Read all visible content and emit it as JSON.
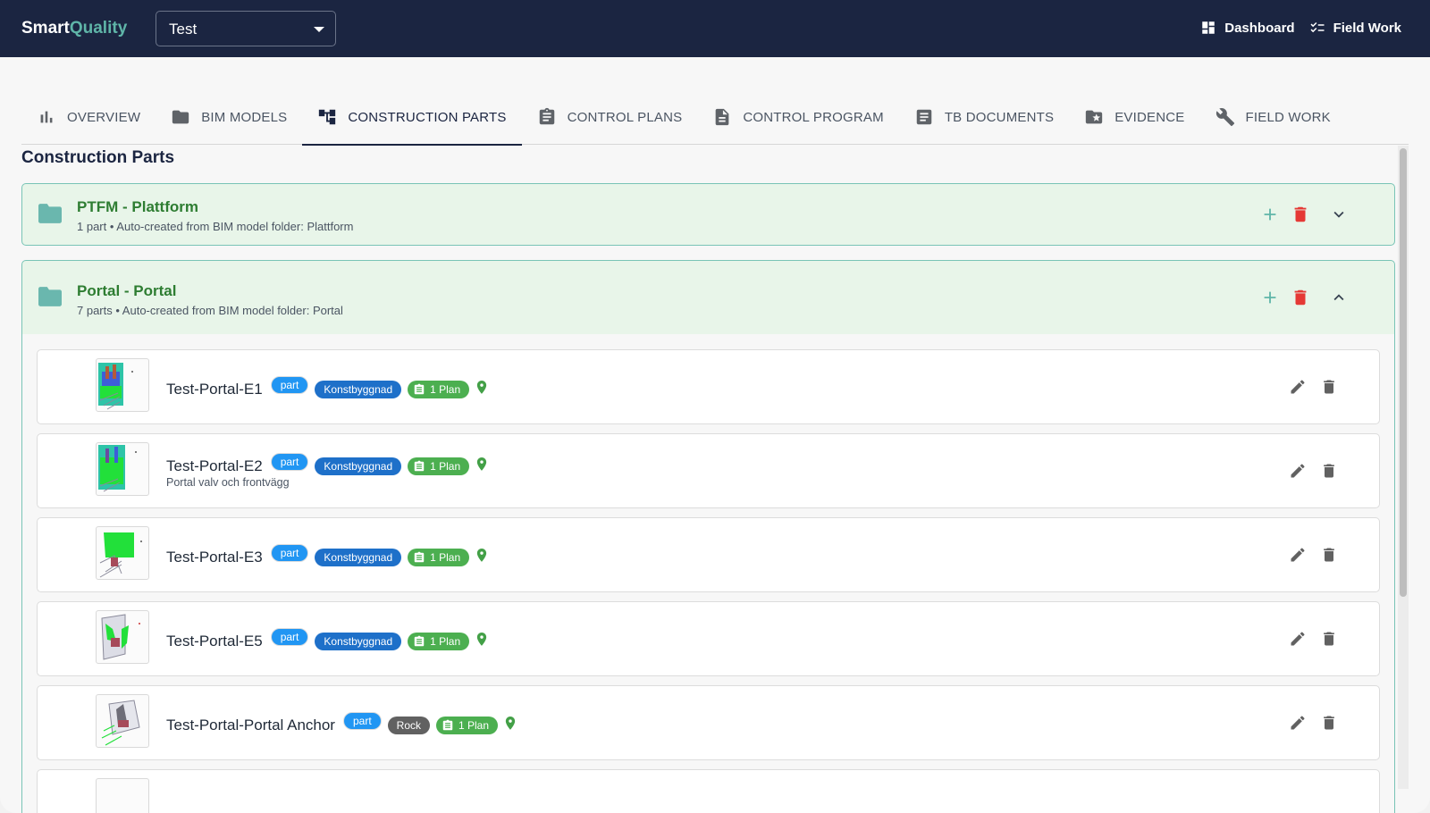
{
  "app": {
    "brand_part1": "Smart",
    "brand_part2": "Quality"
  },
  "project_select": {
    "value": "Test"
  },
  "top_nav": {
    "dashboard": "Dashboard",
    "field_work": "Field Work"
  },
  "tabs": [
    {
      "label": "OVERVIEW",
      "icon": "bar-chart-icon"
    },
    {
      "label": "BIM MODELS",
      "icon": "folder-icon"
    },
    {
      "label": "CONSTRUCTION PARTS",
      "icon": "hierarchy-icon",
      "active": true
    },
    {
      "label": "CONTROL PLANS",
      "icon": "clipboard-icon"
    },
    {
      "label": "CONTROL PROGRAM",
      "icon": "document-icon"
    },
    {
      "label": "TB DOCUMENTS",
      "icon": "article-icon"
    },
    {
      "label": "EVIDENCE",
      "icon": "starred-folder-icon"
    },
    {
      "label": "FIELD WORK",
      "icon": "wrench-icon"
    }
  ],
  "page_title": "Construction Parts",
  "folders": [
    {
      "title": "PTFM - Plattform",
      "subtitle": "1 part • Auto-created from BIM model folder: Plattform",
      "expanded": false
    },
    {
      "title": "Portal - Portal",
      "subtitle": "7 parts • Auto-created from BIM model folder: Portal",
      "expanded": true
    }
  ],
  "parts": [
    {
      "name": "Test-Portal-E1",
      "type": "part",
      "category": "Konstbyggnad",
      "plans": "1 Plan",
      "description": ""
    },
    {
      "name": "Test-Portal-E2",
      "type": "part",
      "category": "Konstbyggnad",
      "plans": "1 Plan",
      "description": "Portal valv och frontvägg"
    },
    {
      "name": "Test-Portal-E3",
      "type": "part",
      "category": "Konstbyggnad",
      "plans": "1 Plan",
      "description": ""
    },
    {
      "name": "Test-Portal-E5",
      "type": "part",
      "category": "Konstbyggnad",
      "plans": "1 Plan",
      "description": ""
    },
    {
      "name": "Test-Portal-Portal Anchor",
      "type": "part",
      "category": "Rock",
      "plans": "1 Plan",
      "description": ""
    }
  ],
  "colors": {
    "topbar": "#1b2541",
    "accent": "#5fb5a8",
    "folder_title": "#2e7d32",
    "delete": "#e53935",
    "part_badge": "#2196f3",
    "plan_badge": "#4caf50"
  }
}
